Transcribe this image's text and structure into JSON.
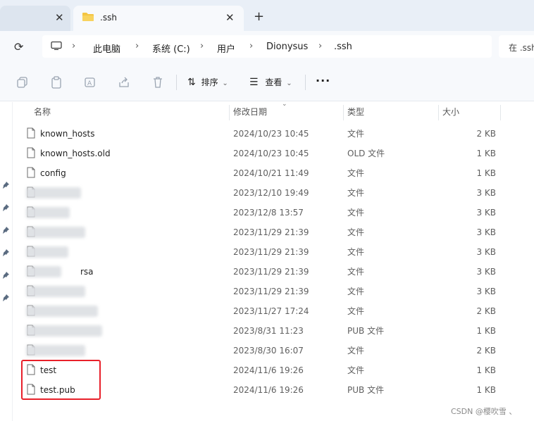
{
  "tabs": {
    "active_title": ".ssh",
    "close_glyph": "✕",
    "new_tab_glyph": "+"
  },
  "address": {
    "breadcrumbs": [
      "此电脑",
      "系统 (C:)",
      "用户",
      "Dionysus",
      ".ssh"
    ],
    "separator": "›",
    "search_placeholder": "在 .ssh"
  },
  "toolbar": {
    "sort_label": "排序",
    "view_label": "查看",
    "more_label": "···",
    "caret": "⌄"
  },
  "columns": {
    "name": "名称",
    "date": "修改日期",
    "type": "类型",
    "size": "大小"
  },
  "files": [
    {
      "name": "known_hosts",
      "date": "2024/10/23 10:45",
      "type": "文件",
      "size": "2 KB"
    },
    {
      "name": "known_hosts.old",
      "date": "2024/10/23 10:45",
      "type": "OLD 文件",
      "size": "1 KB"
    },
    {
      "name": "config",
      "date": "2024/10/21 11:49",
      "type": "文件",
      "size": "1 KB"
    },
    {
      "name": "",
      "date": "2023/12/10 19:49",
      "type": "文件",
      "size": "3 KB"
    },
    {
      "name": "",
      "date": "2023/12/8 13:57",
      "type": "文件",
      "size": "3 KB"
    },
    {
      "name": "",
      "date": "2023/11/29 21:39",
      "type": "文件",
      "size": "3 KB"
    },
    {
      "name": "",
      "date": "2023/11/29 21:39",
      "type": "文件",
      "size": "3 KB"
    },
    {
      "name": "rsa",
      "date": "2023/11/29 21:39",
      "type": "文件",
      "size": "3 KB"
    },
    {
      "name": "",
      "date": "2023/11/29 21:39",
      "type": "文件",
      "size": "3 KB"
    },
    {
      "name": "",
      "date": "2023/11/27 17:24",
      "type": "文件",
      "size": "2 KB"
    },
    {
      "name": "",
      "date": "2023/8/31 11:23",
      "type": "PUB 文件",
      "size": "1 KB"
    },
    {
      "name": "",
      "date": "2023/8/30 16:07",
      "type": "文件",
      "size": "2 KB"
    },
    {
      "name": "test",
      "date": "2024/11/6 19:26",
      "type": "文件",
      "size": "1 KB"
    },
    {
      "name": "test.pub",
      "date": "2024/11/6 19:26",
      "type": "PUB 文件",
      "size": "1 KB"
    }
  ],
  "watermark": "CSDN @樱吹雪 、",
  "colors": {
    "highlight": "#e8202a",
    "folder": "#f4c542"
  }
}
